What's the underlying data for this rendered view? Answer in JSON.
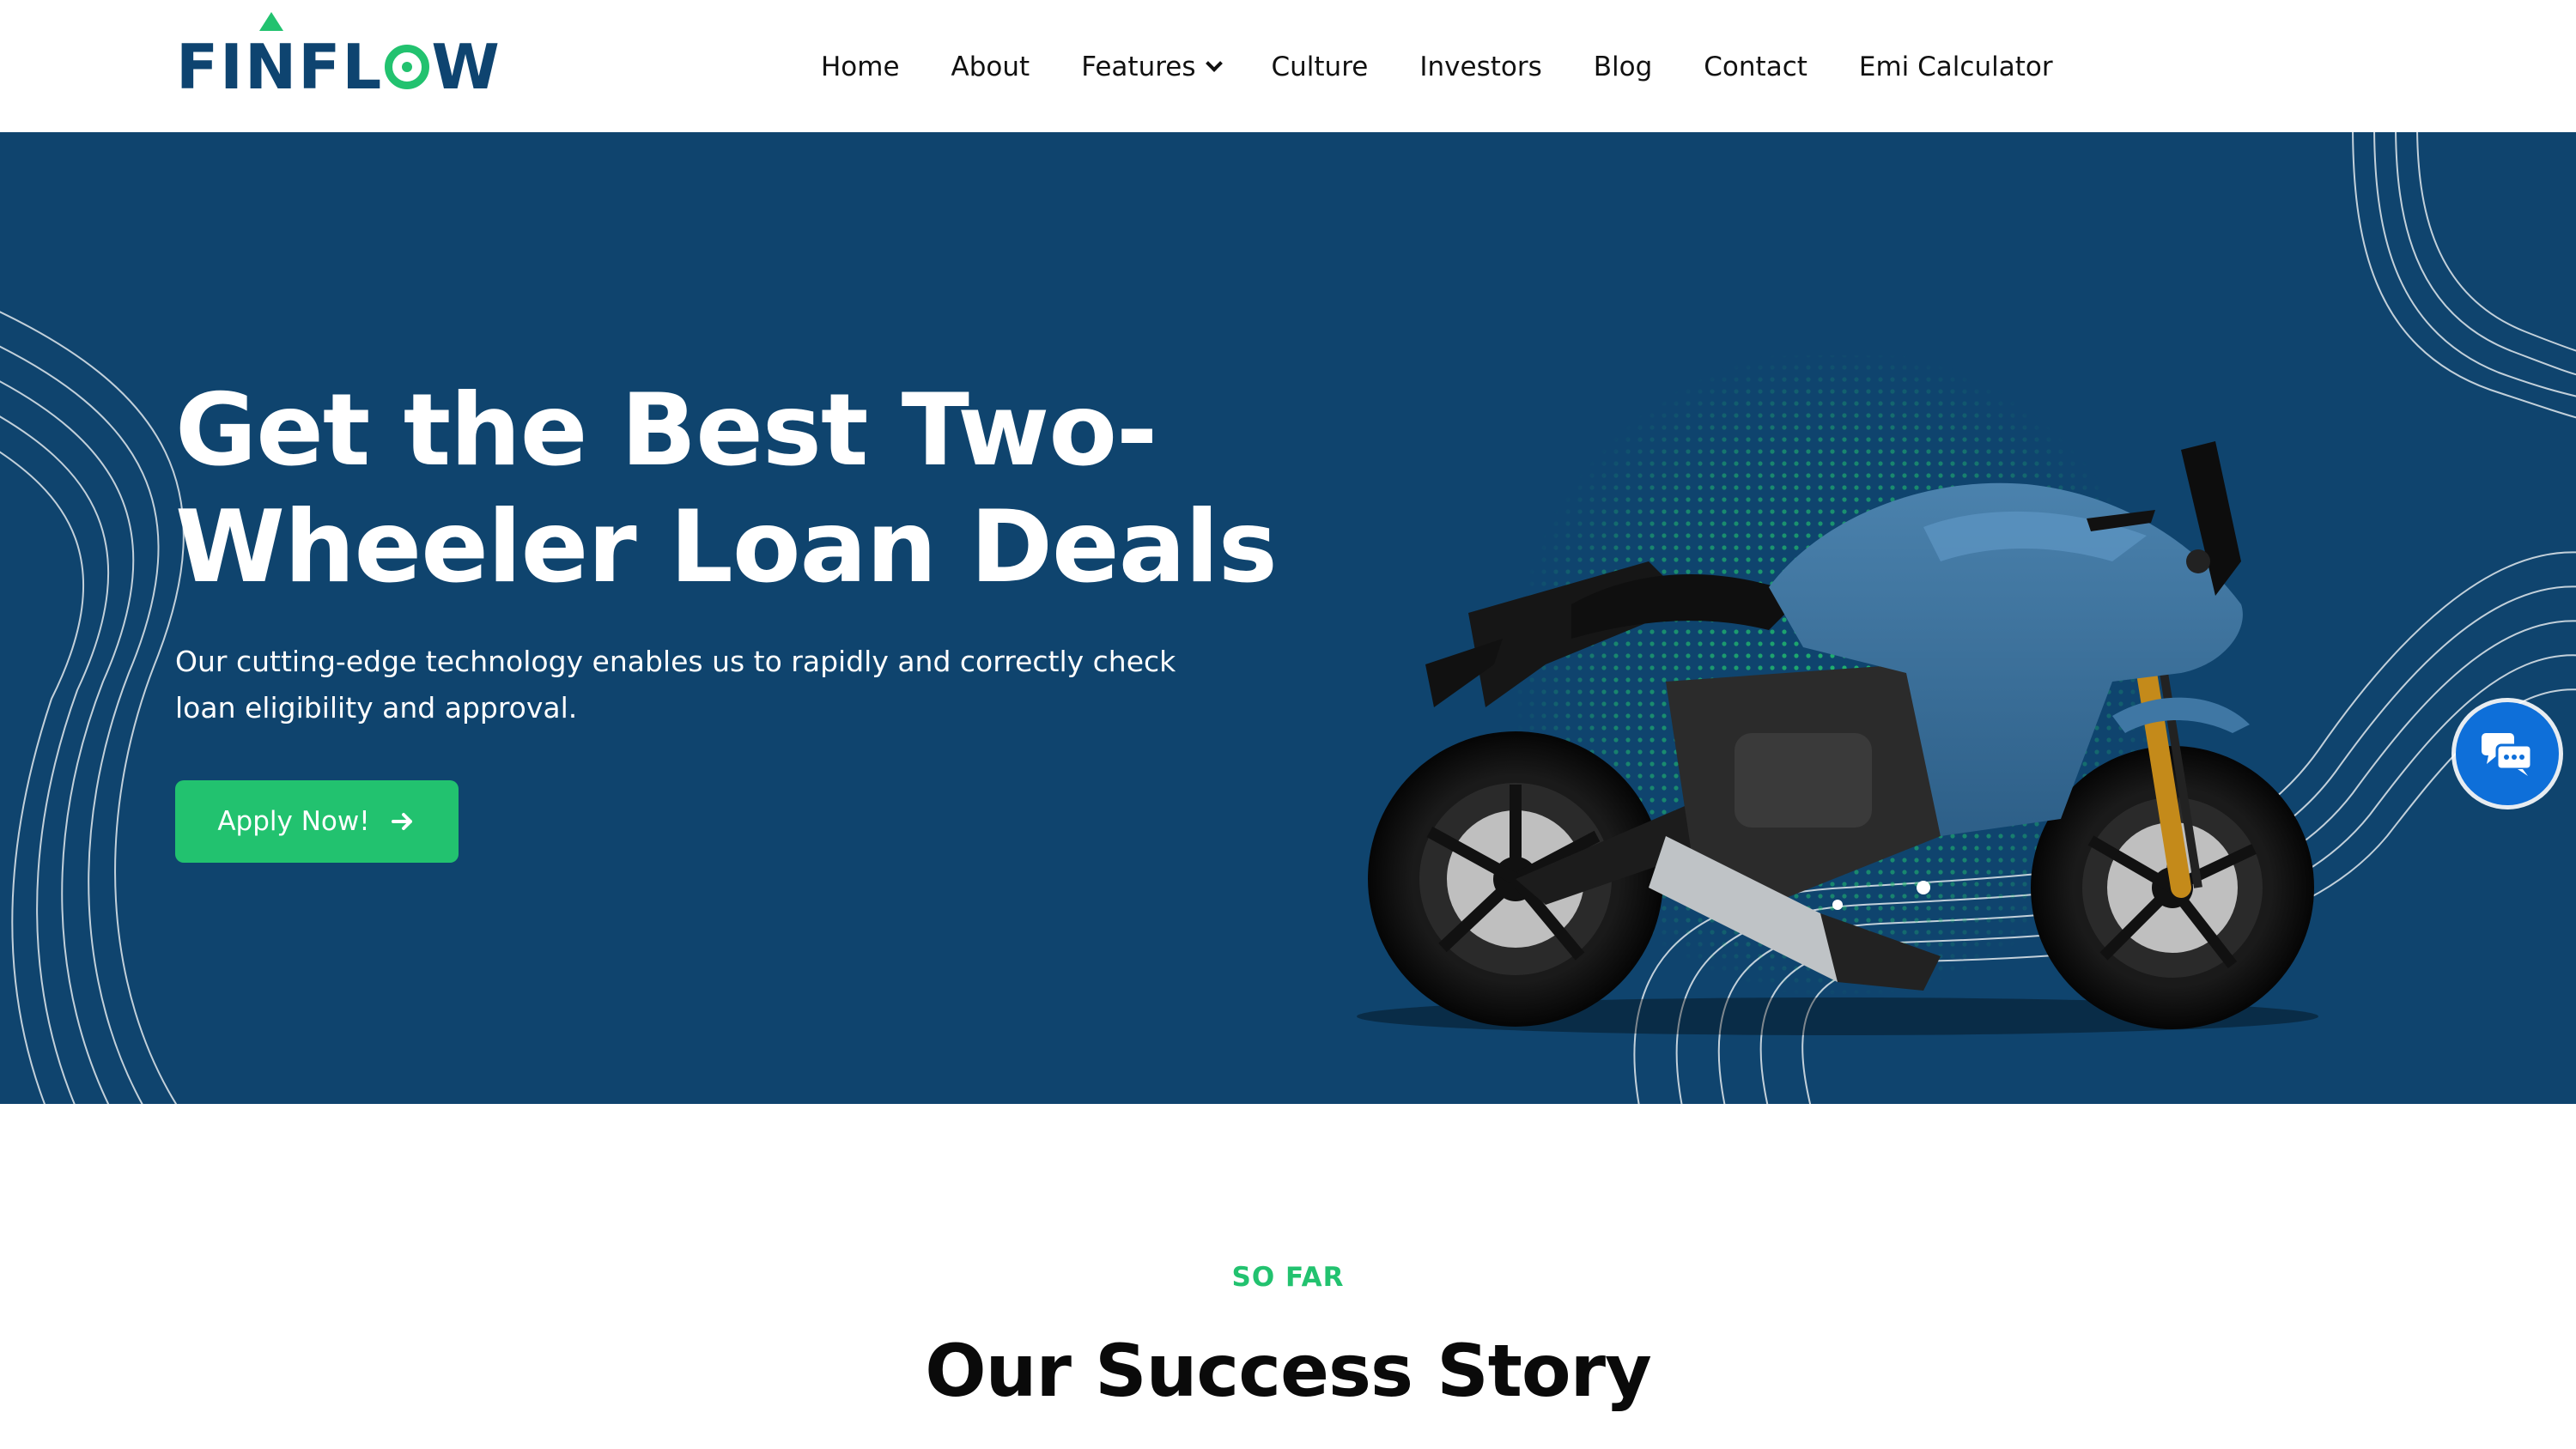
{
  "brand": {
    "logo_text_parts": [
      "FI",
      "N",
      "FL",
      "W"
    ],
    "colors": {
      "navy": "#0f446e",
      "green": "#22c26f",
      "chat_blue": "#0e6fd9"
    }
  },
  "nav": {
    "items": [
      {
        "label": "Home"
      },
      {
        "label": "About"
      },
      {
        "label": "Features",
        "has_dropdown": true,
        "icon": "chevron-down-icon"
      },
      {
        "label": "Culture"
      },
      {
        "label": "Investors"
      },
      {
        "label": "Blog"
      },
      {
        "label": "Contact"
      },
      {
        "label": "Emi Calculator"
      }
    ]
  },
  "hero": {
    "title_line1": "Get the Best Two-",
    "title_line2": "Wheeler Loan Deals",
    "description": "Our cutting-edge technology enables us to rapidly and correctly check loan eligibility and approval.",
    "cta_label": "Apply Now!",
    "cta_icon": "arrow-right-icon",
    "image_icon": "motorcycle-image"
  },
  "chat": {
    "icon": "chat-bubbles-icon"
  },
  "success": {
    "eyebrow": "SO FAR",
    "title": "Our Success Story"
  }
}
